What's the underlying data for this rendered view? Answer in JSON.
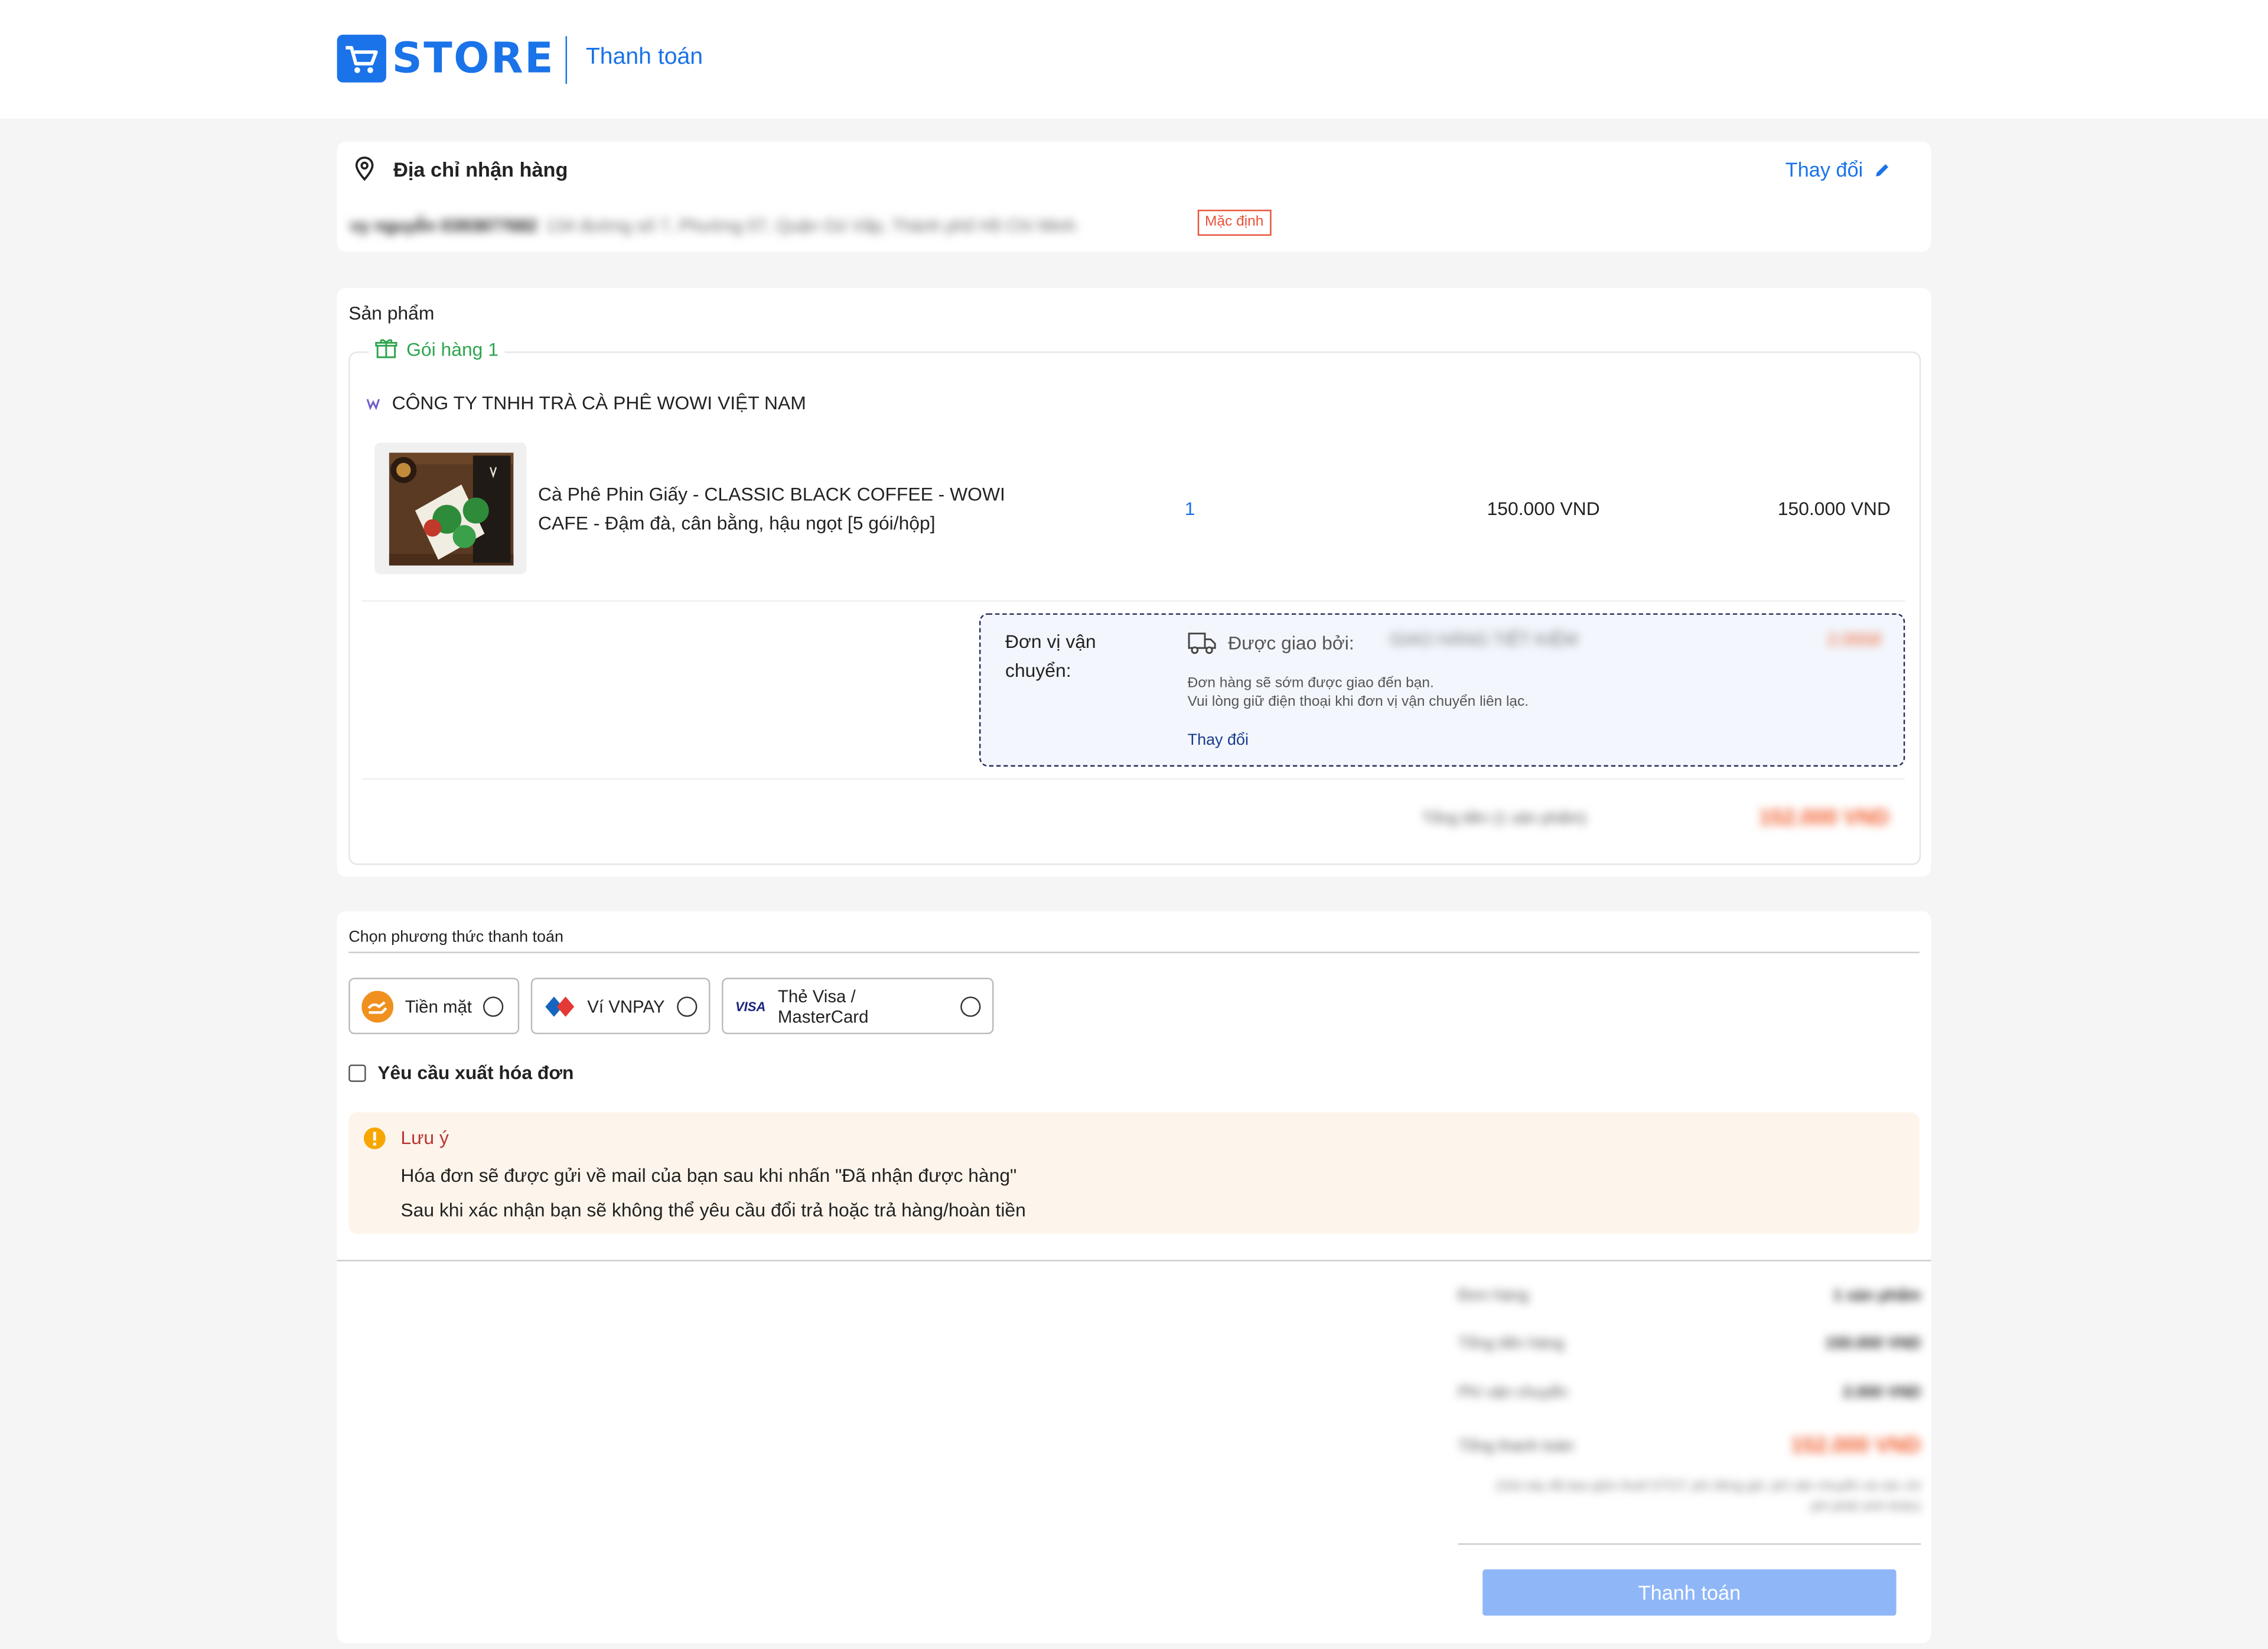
{
  "header": {
    "logo_text": "STORE",
    "page_title": "Thanh toán"
  },
  "address": {
    "title": "Địa chỉ nhận hàng",
    "change_label": "Thay đổi",
    "recipient": "vy nguyễn 0393877682",
    "line": "134 đường số 7, Phường 07, Quận Gò Vấp, Thành phố Hồ Chí Minh",
    "default_badge": "Mặc định"
  },
  "products": {
    "section_title": "Sản phẩm",
    "package_label": "Gói hàng 1",
    "shop_name": "CÔNG TY TNHH TRÀ CÀ PHÊ WOWI VIỆT NAM",
    "item": {
      "name": "Cà Phê Phin Giấy - CLASSIC BLACK COFFEE - WOWI CAFE - Đậm đà, cân bằng, hậu ngọt [5 gói/hộp]",
      "quantity": "1",
      "unit_price": "150.000 VND",
      "total_price": "150.000 VND"
    },
    "shipping": {
      "label": "Đơn vị vận chuyển:",
      "delivered_by": "Được giao bởi:",
      "carrier": "GIAO HÀNG TIẾT KIỆM",
      "fee": "2.000đ",
      "note_line1": "Đơn hàng sẽ sớm được giao đến bạn.",
      "note_line2": "Vui lòng giữ điện thoại khi đơn vị vận chuyển liên lạc.",
      "change_label": "Thay đổi"
    },
    "package_total_label": "Tổng tiền (1 sản phẩm)",
    "package_total_value": "152.000 VND"
  },
  "payment": {
    "title": "Chọn phương thức thanh toán",
    "options": [
      {
        "label": "Tiền mặt",
        "icon": "cash-icon"
      },
      {
        "label": "Ví VNPAY",
        "icon": "vnpay-icon"
      },
      {
        "label": "Thẻ Visa / MasterCard",
        "icon": "visa-icon",
        "icon_text": "VISA"
      }
    ],
    "invoice_label": "Yêu cầu xuất hóa đơn",
    "note_title": "Lưu ý",
    "note_line1": "Hóa đơn sẽ được gửi về mail của bạn sau khi nhấn \"Đã nhận được hàng\"",
    "note_line2": "Sau khi xác nhận bạn sẽ không thể yêu cầu đổi trả hoặc trả hàng/hoàn tiền"
  },
  "summary": {
    "rows": [
      {
        "label": "Đơn hàng",
        "value": "1 sản phẩm"
      },
      {
        "label": "Tổng tiền hàng",
        "value": "150.000 VND"
      },
      {
        "label": "Phí vận chuyển",
        "value": "2.000 VND"
      },
      {
        "label": "Tổng thanh toán",
        "value": "152.000 VND"
      }
    ],
    "fine_print": "(Giá này đã bao gồm thuế GTGT, phí đóng gói, phí vận chuyển và các chi phí phát sinh khác)",
    "pay_button": "Thanh toán"
  },
  "colors": {
    "brand": "#1a73e8",
    "accent_orange": "#f05a28",
    "success_green": "#2ea44f",
    "note_bg": "#fdf5eb",
    "pay_button": "#8fb7f8"
  }
}
